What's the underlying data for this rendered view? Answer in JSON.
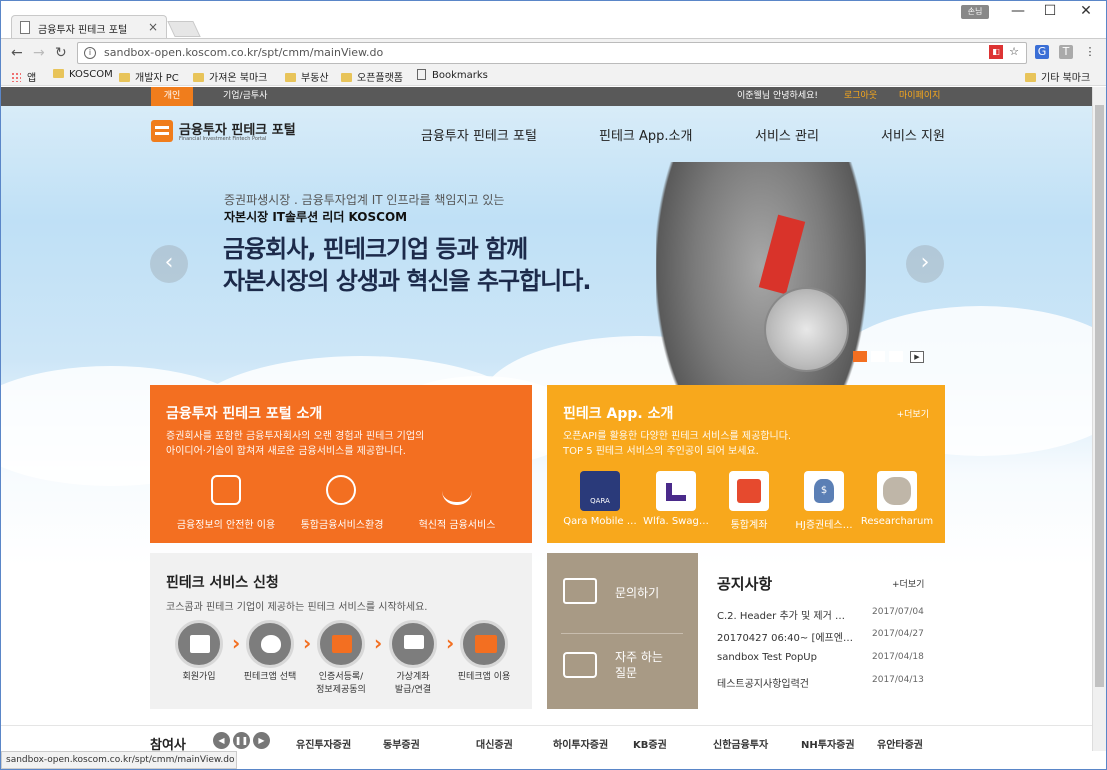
{
  "browser": {
    "tab_title": "금융투자 핀테크 포털",
    "tab_close": "×",
    "profile": "손님",
    "controls": [
      "—",
      "☐",
      "✕"
    ],
    "url": "sandbox-open.koscom.co.kr/spt/cmm/mainView.do",
    "bookmarks": [
      "앱",
      "KOSCOM",
      "개발자 PC",
      "가져온 북마크",
      "부동산",
      "오픈플랫폼",
      "Bookmarks"
    ],
    "other_bookmarks": "기타 북마크",
    "status": "sandbox-open.koscom.co.kr/spt/cmm/mainView.do"
  },
  "top_bar": {
    "tab_personal": "개인",
    "tab_corporate": "기업/금투사",
    "greeting": "이준웰님 안녕하세요!",
    "logout": "로그아웃",
    "mypage": "마이페이지"
  },
  "header": {
    "logo_title": "금융투자 핀테크 포털",
    "logo_subtitle": "Financial Investment Fintech Portal",
    "menu": [
      "금융투자 핀테크 포털",
      "핀테크 App.소개",
      "서비스 관리",
      "서비스 지원"
    ]
  },
  "hero": {
    "sub1": "증권파생시장 . 금융투자업계 IT 인프라를 책임지고 있는",
    "sub2": "자본시장 IT솔루션 리더  KOSCOM",
    "title1": "금융회사, 핀테크기업 등과 함께",
    "title2": "자본시장의 상생과 혁신을 추구합니다.",
    "prev": "‹",
    "next": "›",
    "play": "▶"
  },
  "portal_intro": {
    "title": "금융투자 핀테크 포털 소개",
    "desc1": "증권회사를 포함한 금융투자회사의 오랜 경험과 핀테크 기업의",
    "desc2": "아이디어·기술이 합쳐져 새로운 금융서비스를 제공합니다.",
    "features": [
      "금융정보의 안전한 이용",
      "통합금융서비스환경",
      "혁신적 금융서비스"
    ]
  },
  "app_intro": {
    "title": "핀테크 App. 소개",
    "more": "+더보기",
    "desc1": "오픈API를 활용한 다양한 핀테크 서비스를 제공합니다.",
    "desc2": "TOP 5 핀테크 서비스의 주인공이 되어 보세요.",
    "apps": [
      "Qara Mobile …",
      "Wlfa. Swag…",
      "통합계좌",
      "HJ증권테스…",
      "Researcharum"
    ],
    "app_colors": [
      "#2a3a7a",
      "#ffffff",
      "#e64a2e",
      "#ffffff",
      "#ffffff"
    ]
  },
  "apply": {
    "title": "핀테크 서비스 신청",
    "desc": "코스콤과 핀테크 기업이 제공하는 핀테크 서비스를 시작하세요.",
    "steps": [
      "회원가입",
      "핀테크앱 선택",
      "인증서등록/\n정보제공동의",
      "가상계좌\n발급/연결",
      "핀테크앱 이용"
    ]
  },
  "help": {
    "inquiry": "문의하기",
    "faq1": "자주 하는",
    "faq2": "질문"
  },
  "notice": {
    "title": "공지사항",
    "more": "+더보기",
    "items": [
      {
        "title": "C.2. Header 추가 및 제거 …",
        "date": "2017/07/04"
      },
      {
        "title": "20170427 06:40~ [에프엔…",
        "date": "2017/04/27"
      },
      {
        "title": "sandbox Test PopUp",
        "date": "2017/04/18"
      },
      {
        "title": "테스트공지사항입력건",
        "date": "2017/04/13"
      }
    ]
  },
  "partners": {
    "title": "참여사",
    "logos": [
      "유진투자증권",
      "동부증권",
      "대신증권",
      "하이투자증권",
      "KB증권",
      "신한금융투자",
      "NH투자증권",
      "유안타증권"
    ]
  }
}
